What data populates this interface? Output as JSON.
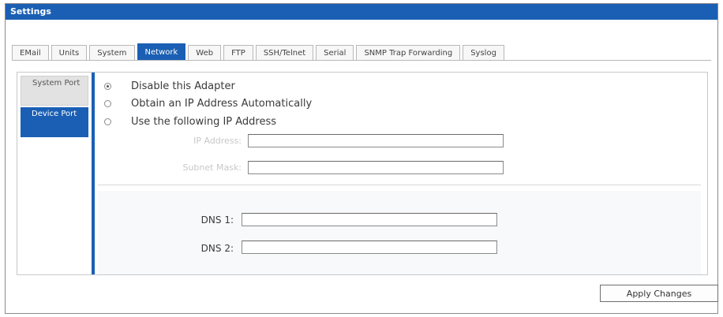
{
  "window": {
    "title": "Settings"
  },
  "tabs": [
    {
      "label": "EMail"
    },
    {
      "label": "Units"
    },
    {
      "label": "System"
    },
    {
      "label": "Network",
      "active": true
    },
    {
      "label": "Web"
    },
    {
      "label": "FTP"
    },
    {
      "label": "SSH/Telnet"
    },
    {
      "label": "Serial"
    },
    {
      "label": "SNMP Trap Forwarding"
    },
    {
      "label": "Syslog"
    }
  ],
  "subnav": [
    {
      "label": "System Port",
      "active": false
    },
    {
      "label": "Device Port",
      "active": true
    }
  ],
  "adapter": {
    "options": [
      {
        "label": "Disable this Adapter",
        "checked": true
      },
      {
        "label": "Obtain an IP Address Automatically",
        "checked": false
      },
      {
        "label": "Use the following IP Address",
        "checked": false
      }
    ],
    "ip_address_label": "IP Address:",
    "ip_address_value": "",
    "subnet_mask_label": "Subnet Mask:",
    "subnet_mask_value": ""
  },
  "dns": {
    "dns1_label": "DNS 1:",
    "dns1_value": "",
    "dns2_label": "DNS 2:",
    "dns2_value": ""
  },
  "actions": {
    "apply_label": "Apply Changes"
  },
  "colors": {
    "accent": "#1a5fb4"
  }
}
